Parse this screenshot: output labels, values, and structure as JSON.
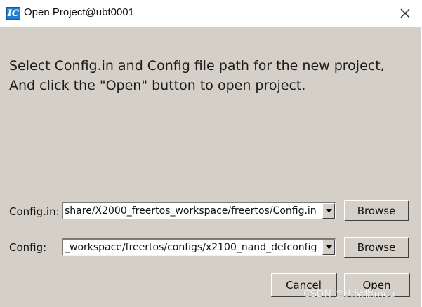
{
  "window": {
    "title": "Open Project@ubt0001",
    "app_icon_text": "IC"
  },
  "message": "Select Config.in and Config file path for the new project, And click the \"Open\" button to open project.",
  "fields": {
    "config_in": {
      "label": "Config.in:",
      "value": "share/X2000_freertos_workspace/freertos/Config.in",
      "browse_label": "Browse"
    },
    "config": {
      "label": "Config:",
      "value": "_workspace/freertos/configs/x2100_nand_defconfig",
      "browse_label": "Browse"
    }
  },
  "buttons": {
    "cancel_label": "Cancel",
    "open_label": "Open"
  },
  "watermark": "CSDN @火柴棍mcu",
  "colors": {
    "dialog_background": "#d4d0c8",
    "titlebar_background": "#ffffff",
    "app_icon": "#1f7fd6"
  },
  "icons": {
    "app": "ic-app-icon",
    "close": "close-icon",
    "dropdown": "dropdown-arrow-icon"
  }
}
